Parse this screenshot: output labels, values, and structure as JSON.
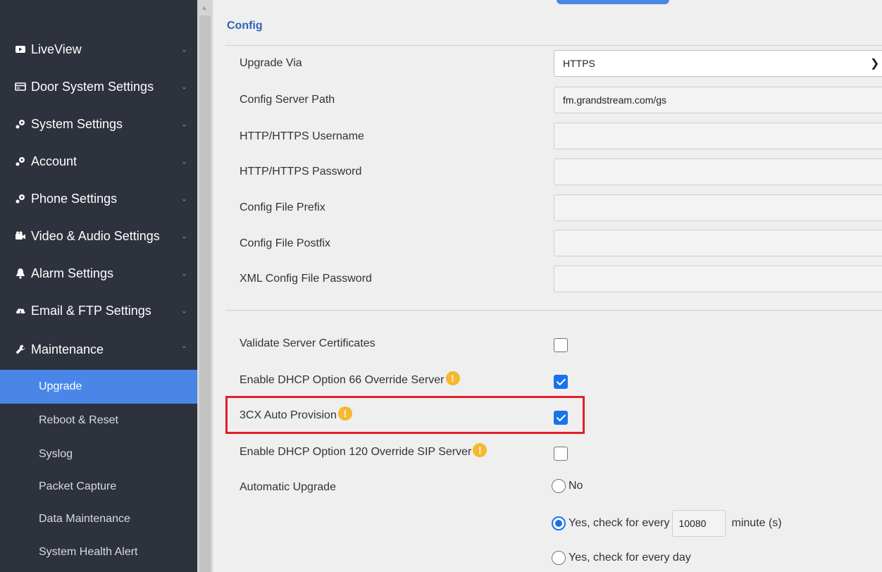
{
  "sidebar": {
    "menu": [
      {
        "label": "LiveView",
        "icon": "video-icon"
      },
      {
        "label": "Door System Settings",
        "icon": "door-card-icon"
      },
      {
        "label": "System Settings",
        "icon": "gears-icon"
      },
      {
        "label": "Account",
        "icon": "gears-icon"
      },
      {
        "label": "Phone Settings",
        "icon": "gears-icon"
      },
      {
        "label": "Video & Audio Settings",
        "icon": "camera-icon"
      },
      {
        "label": "Alarm Settings",
        "icon": "bell-icon"
      },
      {
        "label": "Email & FTP Settings",
        "icon": "cloud-icon"
      },
      {
        "label": "Maintenance",
        "icon": "wrench-icon"
      }
    ],
    "submenu": [
      {
        "label": "Upgrade",
        "active": true
      },
      {
        "label": "Reboot & Reset"
      },
      {
        "label": "Syslog"
      },
      {
        "label": "Packet Capture"
      },
      {
        "label": "Data Maintenance"
      },
      {
        "label": "System Health Alert"
      }
    ]
  },
  "main": {
    "section_title": "Config",
    "fields": {
      "upgrade_via": {
        "label": "Upgrade Via",
        "value": "HTTPS"
      },
      "config_server_path": {
        "label": "Config Server Path",
        "value": "fm.grandstream.com/gs"
      },
      "http_username": {
        "label": "HTTP/HTTPS Username",
        "value": ""
      },
      "http_password": {
        "label": "HTTP/HTTPS Password",
        "value": ""
      },
      "config_prefix": {
        "label": "Config File Prefix",
        "value": ""
      },
      "config_postfix": {
        "label": "Config File Postfix",
        "value": ""
      },
      "xml_password": {
        "label": "XML Config File Password",
        "value": ""
      }
    },
    "checks": {
      "validate_certs": {
        "label": "Validate Server Certificates",
        "checked": false
      },
      "dhcp66": {
        "label": "Enable DHCP Option 66 Override Server",
        "checked": true
      },
      "auto_provision": {
        "label": "3CX Auto Provision",
        "checked": true
      },
      "dhcp120": {
        "label": "Enable DHCP Option 120 Override SIP Server",
        "checked": false
      }
    },
    "automatic_upgrade": {
      "label": "Automatic Upgrade",
      "opt_no": "No",
      "opt_every_prefix": "Yes, check for every",
      "minutes_value": "10080",
      "opt_every_suffix": "minute (s)",
      "opt_every_day": "Yes, check for every day",
      "selected": "every"
    }
  },
  "colors": {
    "sidebar_bg": "#2e323c",
    "accent": "#4a86e8",
    "section_title": "#2d63b8",
    "highlight": "#e0202a",
    "warning": "#f5b82e"
  }
}
